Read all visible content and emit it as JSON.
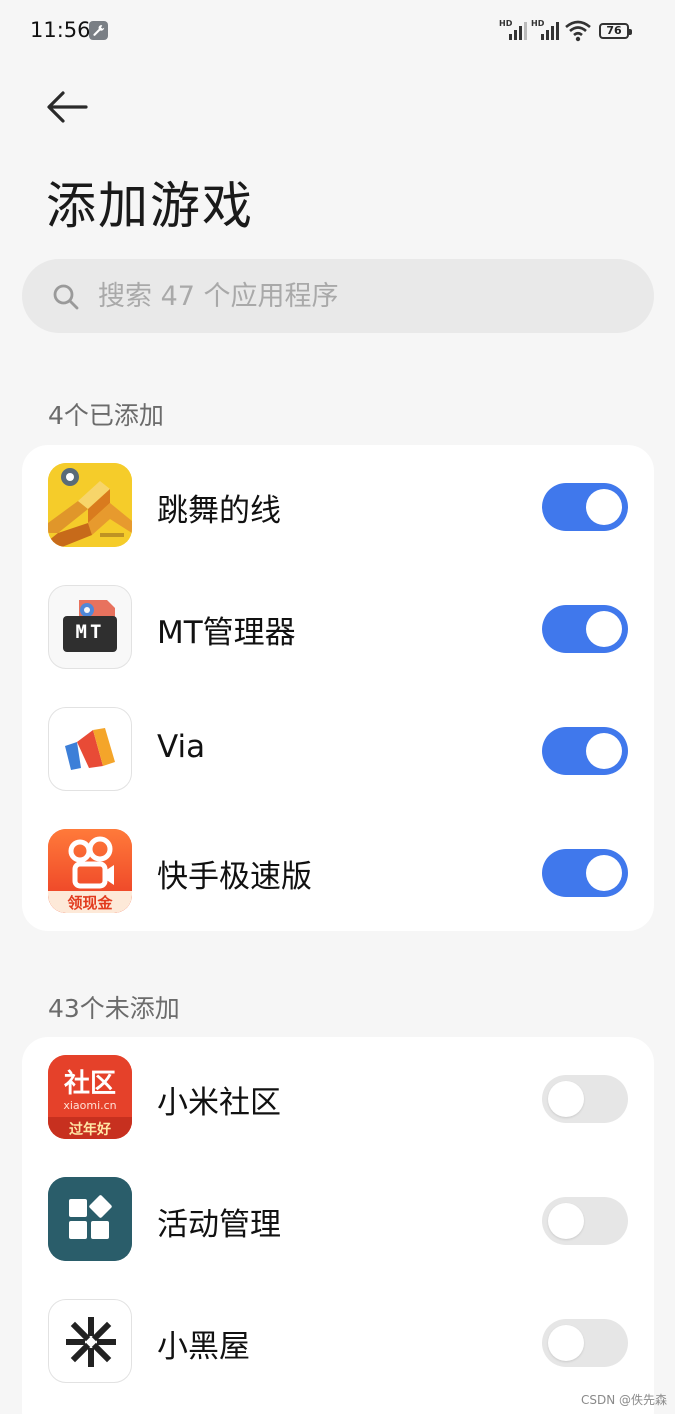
{
  "status_bar": {
    "time": "11:56",
    "hd1": "HD",
    "hd2": "HD",
    "battery": "76"
  },
  "page": {
    "title": "添加游戏"
  },
  "search": {
    "placeholder": "搜索 47 个应用程序"
  },
  "added": {
    "header": "4个已添加",
    "apps": [
      {
        "name": "跳舞的线",
        "icon": "dancing-line-icon",
        "enabled": true
      },
      {
        "name": "MT管理器",
        "icon": "mt-manager-icon",
        "enabled": true
      },
      {
        "name": "Via",
        "icon": "via-browser-icon",
        "enabled": true
      },
      {
        "name": "快手极速版",
        "icon": "kuaishou-lite-icon",
        "enabled": true
      }
    ]
  },
  "not_added": {
    "header": "43个未添加",
    "apps": [
      {
        "name": "小米社区",
        "icon": "xiaomi-community-icon",
        "enabled": false
      },
      {
        "name": "活动管理",
        "icon": "activity-manager-icon",
        "enabled": false
      },
      {
        "name": "小黑屋",
        "icon": "little-black-room-icon",
        "enabled": false
      }
    ]
  },
  "icon_text": {
    "mt": "MT",
    "kuaishou_badge": "领现金",
    "xiaomi_title": "社区",
    "xiaomi_domain": "xiaomi.cn",
    "xiaomi_banner": "过年好"
  },
  "colors": {
    "toggle_on": "#4078ec",
    "toggle_off": "#e6e6e6",
    "background": "#f6f6f6"
  },
  "watermark": "CSDN @佚先森"
}
